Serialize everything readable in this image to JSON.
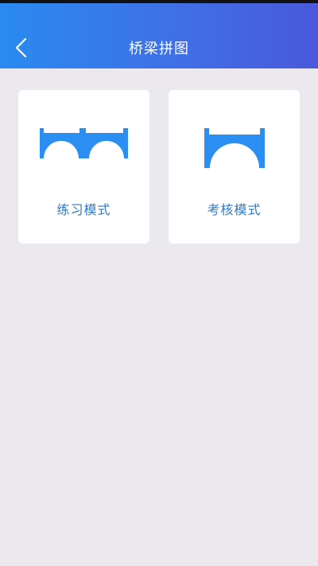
{
  "header": {
    "title": "桥梁拼图",
    "back_icon": "chevron-left-icon"
  },
  "cards": [
    {
      "label": "练习模式",
      "icon": "double-arch-bridge-icon"
    },
    {
      "label": "考核模式",
      "icon": "single-arch-bridge-icon"
    }
  ],
  "colors": {
    "header_gradient_start": "#2a8af0",
    "header_gradient_end": "#4a58dc",
    "icon_blue": "#2a8ff0",
    "label_blue": "#2f78c8",
    "background": "#ebe8ee",
    "card": "#ffffff"
  }
}
